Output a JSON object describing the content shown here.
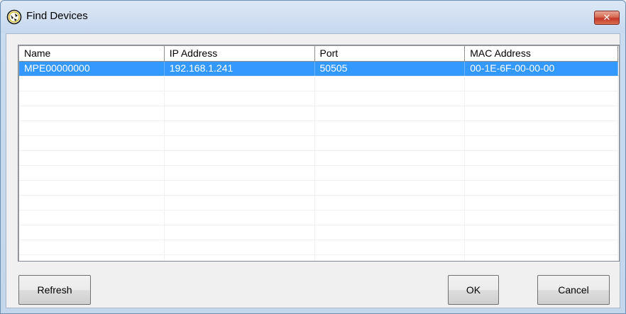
{
  "window": {
    "title": "Find Devices",
    "close_label": "x"
  },
  "list": {
    "columns": [
      "Name",
      "IP Address",
      "Port",
      "MAC Address"
    ],
    "rows": [
      {
        "name": "MPE00000000",
        "ip": "192.168.1.241",
        "port": "50505",
        "mac": "00-1E-6F-00-00-00",
        "selected": true
      }
    ],
    "empty_rows": 13,
    "selection_color": "#3399ff"
  },
  "buttons": {
    "refresh": "Refresh",
    "ok": "OK",
    "cancel": "Cancel"
  },
  "icons": {
    "app": "device-search-icon",
    "close": "close-icon"
  }
}
